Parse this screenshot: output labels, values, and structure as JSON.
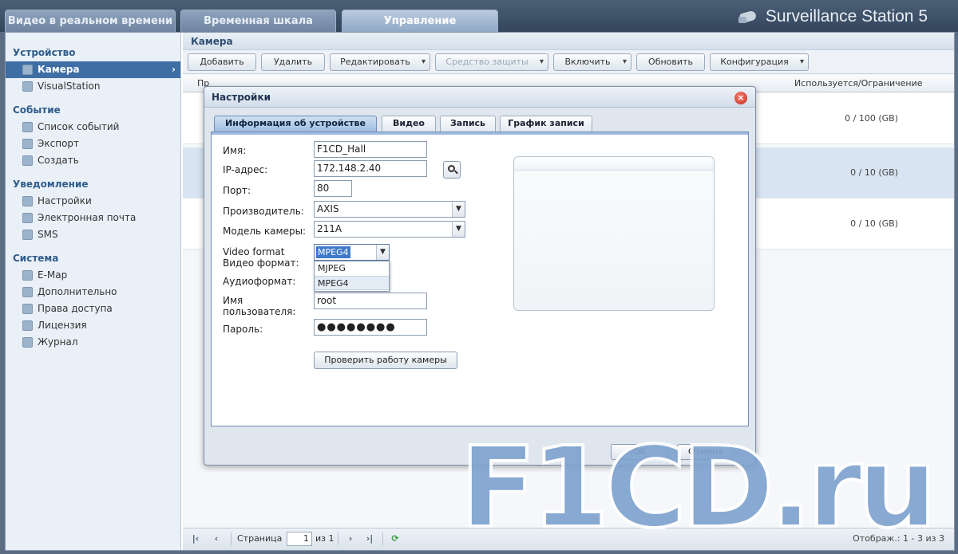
{
  "top_tabs": [
    {
      "label": "Видео в реальном времени"
    },
    {
      "label": "Временная шкала"
    },
    {
      "label": "Управление"
    }
  ],
  "brand": {
    "name": "Surveillance Station 5"
  },
  "sidebar": {
    "sections": [
      {
        "title": "Устройство",
        "items": [
          {
            "label": "Камера",
            "icon": "camera-icon"
          },
          {
            "label": "VisualStation",
            "icon": "visualstation-icon"
          }
        ]
      },
      {
        "title": "Событие",
        "items": [
          {
            "label": "Список событий",
            "icon": "list-icon"
          },
          {
            "label": "Экспорт",
            "icon": "export-icon"
          },
          {
            "label": "Создать",
            "icon": "create-icon"
          }
        ]
      },
      {
        "title": "Уведомление",
        "items": [
          {
            "label": "Настройки",
            "icon": "wrench-icon"
          },
          {
            "label": "Электронная почта",
            "icon": "mail-icon"
          },
          {
            "label": "SMS",
            "icon": "sms-icon"
          }
        ]
      },
      {
        "title": "Система",
        "items": [
          {
            "label": "E-Map",
            "icon": "map-icon"
          },
          {
            "label": "Дополнительно",
            "icon": "gear-icon"
          },
          {
            "label": "Права доступа",
            "icon": "users-icon"
          },
          {
            "label": "Лицензия",
            "icon": "key-icon"
          },
          {
            "label": "Журнал",
            "icon": "book-icon"
          }
        ]
      }
    ]
  },
  "main": {
    "panel_title": "Камера",
    "toolbar": {
      "add": "Добавить",
      "delete": "Удалить",
      "edit": "Редактировать",
      "protection": "Средство защиты",
      "enable": "Включить",
      "refresh": "Обновить",
      "config": "Конфигурация"
    },
    "grid_header": {
      "col1": "Пр",
      "usage": "Используется/Ограничение"
    },
    "rows": [
      {
        "usage": "0 / 100 (GB)"
      },
      {
        "usage": "0 / 10 (GB)"
      },
      {
        "usage": "0 / 10 (GB)"
      }
    ],
    "pager": {
      "page_label": "Страница",
      "page_value": "1",
      "of_label": "из 1",
      "display": "Отображ.: 1 - 3 из 3"
    }
  },
  "modal": {
    "title": "Настройки",
    "tabs": [
      {
        "label": "Информация об устройстве"
      },
      {
        "label": "Видео"
      },
      {
        "label": "Запись"
      },
      {
        "label": "График записи"
      }
    ],
    "fields": {
      "name_label": "Имя:",
      "name_value": "F1CD_Hall",
      "ip_label": "IP-адрес:",
      "ip_value": "172.148.2.40",
      "port_label": "Порт:",
      "port_value": "80",
      "vendor_label": "Производитель:",
      "vendor_value": "AXIS",
      "model_label": "Модель камеры:",
      "model_value": "211A",
      "video_format_label_en": "Video format",
      "video_format_label_ru": "Видео формат:",
      "video_format_value": "MPEG4",
      "video_format_options": [
        "MJPEG",
        "MPEG4"
      ],
      "audio_label": "Аудиоформат:",
      "user_label_1": "Имя",
      "user_label_2": "пользователя:",
      "user_value": "root",
      "password_label": "Пароль:",
      "password_dots": "●●●●●●●●",
      "test_button": "Проверить работу камеры"
    },
    "footer": {
      "ok": "OK",
      "cancel": "Отмена"
    }
  },
  "watermark": "F1CD.ru"
}
